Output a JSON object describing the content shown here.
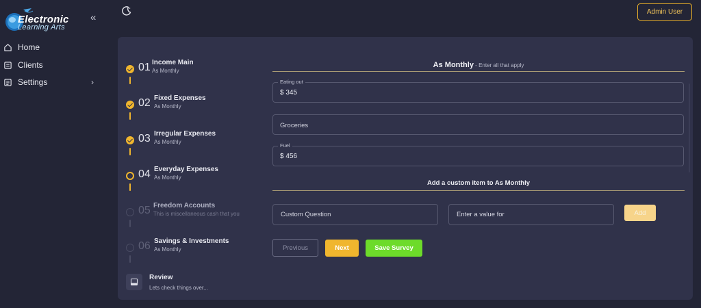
{
  "brand": {
    "line1": "Electronic",
    "line2": "Learning Arts"
  },
  "sidebar": {
    "items": [
      {
        "label": "Home"
      },
      {
        "label": "Clients"
      },
      {
        "label": "Settings"
      }
    ]
  },
  "header": {
    "user_button": "Admin User"
  },
  "steps": [
    {
      "num": "01",
      "title": "Income Main",
      "sub": "As Monthly",
      "state": "done"
    },
    {
      "num": "02",
      "title": "Fixed Expenses",
      "sub": "As Monthly",
      "state": "done"
    },
    {
      "num": "03",
      "title": "Irregular Expenses",
      "sub": "As Monthly",
      "state": "done"
    },
    {
      "num": "04",
      "title": "Everyday Expenses",
      "sub": "As Monthly",
      "state": "active"
    },
    {
      "num": "05",
      "title": "Freedom Accounts",
      "sub": "This is miscellaneous cash that you",
      "state": "todo"
    },
    {
      "num": "06",
      "title": "Savings & Investments",
      "sub": "As Monthly",
      "state": "todo"
    }
  ],
  "review": {
    "title": "Review",
    "sub": "Lets check things over..."
  },
  "form": {
    "title": "As Monthly",
    "subtitle": " - Enter all that apply",
    "fields": [
      {
        "label": "Eating out",
        "value": "$ 345"
      },
      {
        "placeholder": "Groceries"
      },
      {
        "label": "Fuel",
        "value": "$ 456"
      }
    ],
    "custom_title": "Add a custom item to As Monthly",
    "custom_question_placeholder": "Custom Question",
    "custom_value_placeholder": "Enter a value for",
    "add_label": "Add",
    "previous_label": "Previous",
    "next_label": "Next",
    "save_label": "Save Survey"
  },
  "colors": {
    "accent": "#f0b62e",
    "success": "#6ddb2a",
    "background": "#232536",
    "card": "#30324a"
  },
  "icons": [
    "logo-icon",
    "collapse-icon",
    "home-icon",
    "clients-icon",
    "settings-icon",
    "chevron-right-icon",
    "moon-icon",
    "check-icon",
    "review-icon"
  ]
}
